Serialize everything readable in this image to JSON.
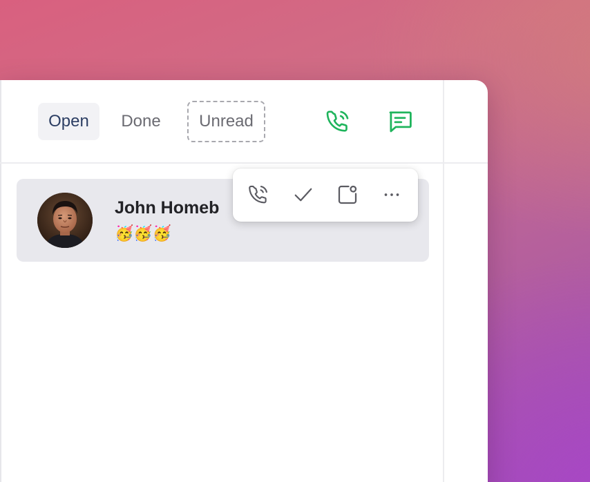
{
  "tabs": {
    "open_label": "Open",
    "done_label": "Done",
    "unread_label": "Unread"
  },
  "header_actions": {
    "call_icon": "phone-call-icon",
    "message_icon": "message-square-icon",
    "accent_color": "#1fb45c"
  },
  "conversation": {
    "name": "John Homeb",
    "preview": "🥳🥳🥳",
    "avatar_icon": "avatar-photo",
    "selected_bg": "#e8e8ed"
  },
  "hover_toolbar": {
    "actions": [
      {
        "icon": "phone-call-icon"
      },
      {
        "icon": "check-icon"
      },
      {
        "icon": "mark-unread-icon"
      },
      {
        "icon": "more-horizontal-icon"
      }
    ]
  }
}
